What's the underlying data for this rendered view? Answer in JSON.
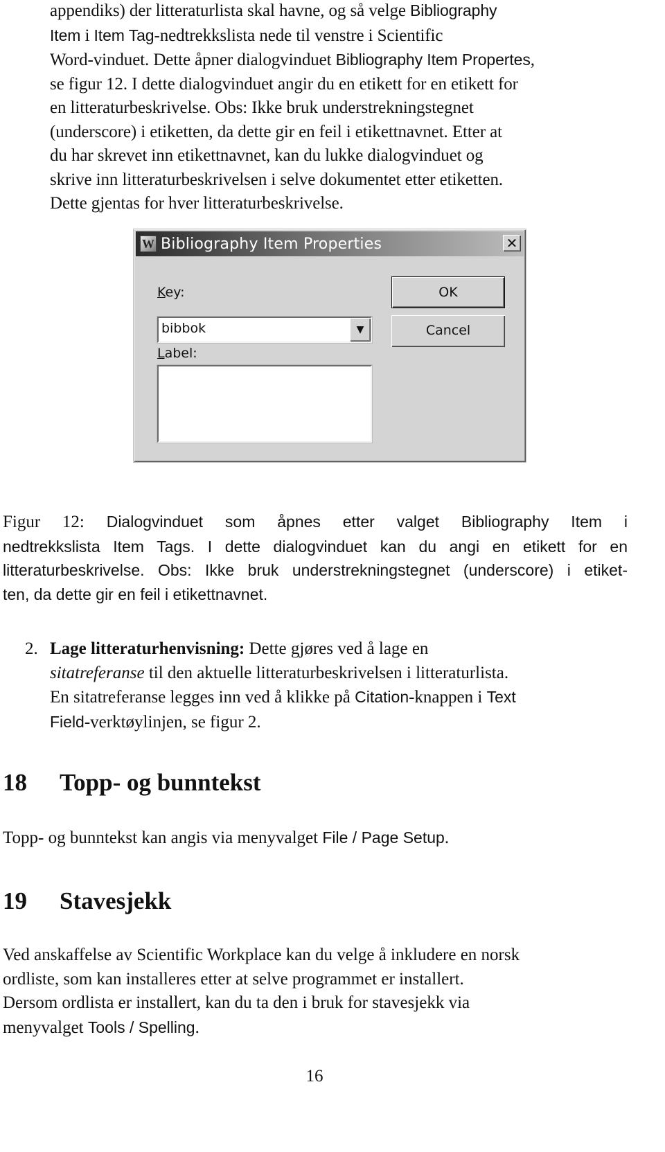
{
  "intro_paragraph": {
    "lines": [
      {
        "pre": "appendiks) der litteraturlista skal havne, og så velge ",
        "sf": "Bibliography",
        "post": ""
      },
      {
        "pre": "",
        "sf": "Item",
        "mid": " i ",
        "sf2": "Item Tag",
        "post": "-nedtrekkslista nede til venstre i Scientific"
      },
      {
        "pre": "Word-vinduet. Dette åpner dialogvinduet ",
        "sf": "Bibliography Item Propertes",
        "post": ","
      },
      {
        "pre": "se figur 12. I dette dialogvinduet angir du en etikett for en etikett for",
        "sf": "",
        "post": ""
      },
      {
        "pre": "en litteraturbeskrivelse. Obs: Ikke bruk understrekningstegnet",
        "sf": "",
        "post": ""
      },
      {
        "pre": "(underscore) i etiketten, da dette gir en feil i etikettnavnet. Etter at",
        "sf": "",
        "post": ""
      },
      {
        "pre": "du har skrevet inn etikettnavnet, kan du lukke dialogvinduet og",
        "sf": "",
        "post": ""
      },
      {
        "pre": "skrive inn litteraturbeskrivelsen i selve dokumentet etter etiketten.",
        "sf": "",
        "post": ""
      },
      {
        "pre": "Dette gjentas for hver litteraturbeskrivelse.",
        "sf": "",
        "post": ""
      }
    ]
  },
  "dialog": {
    "title": "Bibliography Item Properties",
    "app_icon_glyph": "W",
    "close_glyph": "✕",
    "key_label_accel": "K",
    "key_label_rest": "ey:",
    "key_value": "bibbok",
    "dropdown_glyph": "▼",
    "label_label_accel": "L",
    "label_label_rest": "abel:",
    "label_value": "",
    "ok_label": "OK",
    "cancel_label": "Cancel"
  },
  "caption": {
    "label": "Figur 12:",
    "line1": "Dialogvinduet som åpnes etter valget Bibliography Item i",
    "line2": "nedtrekkslista Item Tags. I dette dialogvinduet kan du angi en etikett for en",
    "line3": "litteraturbeskrivelse. Obs: Ikke bruk understrekningstegnet (underscore) i etiket-",
    "line4": "ten, da dette gir en feil i etikettnavnet."
  },
  "list_item": {
    "number": "2.",
    "bold": "Lage litteraturhenvisning:",
    "l1_rest": " Dette gjøres ved å lage en",
    "l2_italic": "sitatreferanse",
    "l2_rest": " til den aktuelle litteraturbeskrivelsen i litteraturlista.",
    "l3_pre": "En sitatreferanse legges inn ved å klikke på ",
    "l3_sf": "Citation",
    "l3_mid": "-knappen i ",
    "l3_sf2": "Text",
    "l4_sf": "Field",
    "l4_rest": "-verktøylinjen, se figur 2."
  },
  "section18": {
    "number": "18",
    "title": "Topp- og bunntekst",
    "text_pre": "Topp- og bunntekst kan angis via menyvalget ",
    "text_sf": "File / Page Setup",
    "text_post": "."
  },
  "section19": {
    "number": "19",
    "title": "Stavesjekk",
    "line1": "Ved anskaffelse av Scientific Workplace kan du velge å inkludere en norsk",
    "line2": "ordliste, som kan installeres etter at selve programmet er installert.",
    "line3": "Dersom ordlista er installert, kan du ta den i bruk for stavesjekk via",
    "line4_pre": "menyvalget ",
    "line4_sf": "Tools / Spelling",
    "line4_post": "."
  },
  "page_number": "16"
}
